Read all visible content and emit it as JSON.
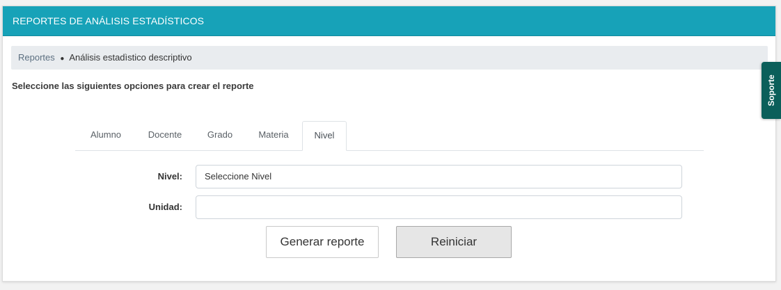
{
  "header": {
    "title": "REPORTES DE ANÁLISIS ESTADÍSTICOS",
    "color": "#17a2b8"
  },
  "breadcrumb": {
    "link": "Reportes",
    "separator": "●",
    "current": "Análisis estadìstico descriptivo"
  },
  "instruction": "Seleccione las siguientes opciones para crear el reporte",
  "tabs": [
    {
      "label": "Alumno",
      "active": false
    },
    {
      "label": "Docente",
      "active": false
    },
    {
      "label": "Grado",
      "active": false
    },
    {
      "label": "Materia",
      "active": false
    },
    {
      "label": "Nivel",
      "active": true
    }
  ],
  "form": {
    "nivel_label": "Nivel:",
    "nivel_value": "Seleccione Nivel",
    "unidad_label": "Unidad:",
    "unidad_value": ""
  },
  "buttons": {
    "generate": "Generar reporte",
    "reset": "Reiniciar"
  },
  "support": {
    "label": "Soporte",
    "color": "#0b5f5a"
  }
}
